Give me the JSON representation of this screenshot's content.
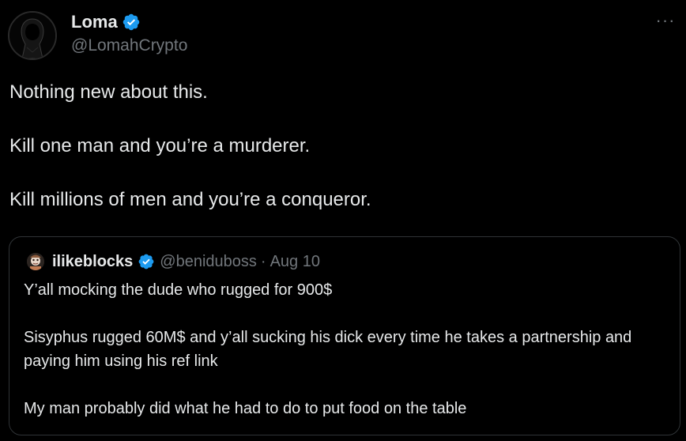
{
  "author": {
    "display_name": "Loma",
    "handle": "@LomahCrypto",
    "verified": true
  },
  "menu": {
    "more_label": "···"
  },
  "tweet": {
    "lines": [
      "Nothing new about this.",
      "Kill one man and you’re a murderer.",
      "Kill millions of men and you’re a conqueror."
    ]
  },
  "quoted_tweet": {
    "display_name": "ilikeblocks",
    "handle": "@beniduboss",
    "separator": "·",
    "date": "Aug 10",
    "verified": true,
    "lines": [
      "Y’all mocking the dude who rugged for 900$",
      "Sisyphus rugged 60M$ and y’all sucking his dick every time he takes a partnership and paying him using his ref link",
      "My man probably did what he had to do to put food on the table"
    ]
  },
  "colors": {
    "background": "#000000",
    "text_primary": "#e7e9ea",
    "text_secondary": "#71767b",
    "verified_blue": "#1d9bf0",
    "border": "#2f3336"
  },
  "icons": {
    "avatar": "hooded-figure-avatar",
    "verified": "verified-badge-icon",
    "more": "more-horizontal-icon",
    "quote_avatar": "cartoon-avatar"
  }
}
